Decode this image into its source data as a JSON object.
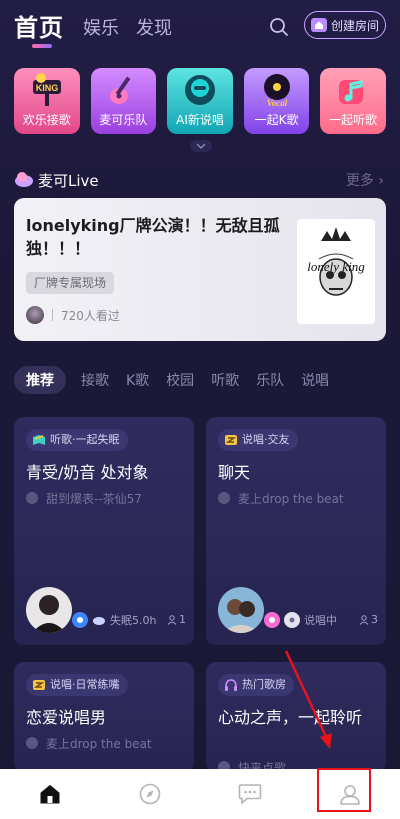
{
  "header": {
    "tab_home": "首页",
    "tab_entertainment": "娱乐",
    "tab_discover": "发现",
    "create_room": "创建房间"
  },
  "categories": [
    {
      "label": "欢乐接歌"
    },
    {
      "label": "麦可乐队"
    },
    {
      "label": "AI新说唱"
    },
    {
      "label": "一起K歌"
    },
    {
      "label": "一起听歌"
    }
  ],
  "live_section": {
    "title": "麦可Live",
    "more": "更多 ›",
    "card": {
      "title": "lonelyking厂牌公演！！无敌且孤独！！！",
      "tag": "厂牌专属现场",
      "viewers": "720人看过",
      "cover_text": "lonely king"
    }
  },
  "filters": [
    "推荐",
    "接歌",
    "K歌",
    "校园",
    "听歌",
    "乐队",
    "说唱"
  ],
  "rooms": [
    {
      "tag": "听歌·一起失眠",
      "title": "青受/奶音 处对象",
      "sub": "甜到爆表--茶仙57",
      "status": "失眠5.0h",
      "count": "1"
    },
    {
      "tag": "说唱·交友",
      "title": "聊天",
      "sub": "麦上drop the beat",
      "status": "说唱中",
      "count": "3"
    },
    {
      "tag": "说唱·日常练嘴",
      "title": "恋爱说唱男",
      "sub": "麦上drop the beat"
    },
    {
      "tag": "热门歌房",
      "title": "心动之声，一起聆听",
      "sub": "快来点歌"
    }
  ],
  "colors": {
    "background": "#1b1836",
    "card": "#2c2858",
    "accent_pink": "#ff6ba7",
    "accent_purple": "#8e6bff",
    "highlight": "#e8121a"
  }
}
